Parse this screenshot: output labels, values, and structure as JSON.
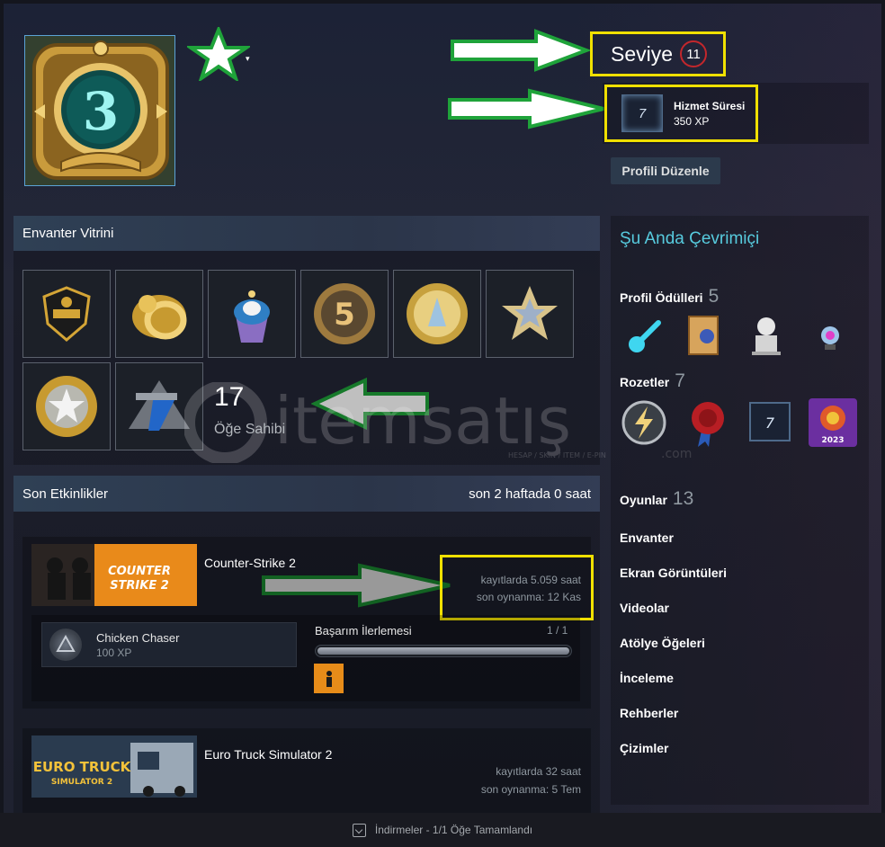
{
  "profile": {
    "level_label": "Seviye",
    "level": "11",
    "badge": {
      "title": "Hizmet Süresi",
      "xp": "350 XP",
      "glyph": "7"
    },
    "edit_label": "Profili Düzenle"
  },
  "showcase": {
    "title": "Envanter Vitrini",
    "count": "17",
    "count_label": "Öğe Sahibi"
  },
  "activity": {
    "title": "Son Etkinlikler",
    "summary": "son 2 haftada 0 saat",
    "games": [
      {
        "name": "Counter-Strike 2",
        "hours": "kayıtlarda 5.059 saat",
        "last_played": "son oynanma: 12 Kas",
        "capsule_text_1": "COUNTER",
        "capsule_text_2": "STRIKE 2"
      },
      {
        "name": "Euro Truck Simulator 2",
        "hours": "kayıtlarda 32 saat",
        "last_played": "son oynanma: 5 Tem",
        "capsule_text_1": "EURO TRUCK",
        "capsule_text_2": "SIMULATOR 2"
      }
    ],
    "achievement": {
      "name": "Chicken Chaser",
      "xp": "100 XP",
      "progress_label": "Başarım İlerlemesi",
      "progress_count": "1 / 1",
      "progress_fraction": 1.0
    }
  },
  "sidebar": {
    "status": "Şu Anda Çevrimiçi",
    "awards_label": "Profil Ödülleri",
    "awards_count": "5",
    "badges_label": "Rozetler",
    "badges_count": "7",
    "badge_year": "2023",
    "games_label": "Oyunlar",
    "games_count": "13",
    "links": [
      "Envanter",
      "Ekran Görüntüleri",
      "Videolar",
      "Atölye Öğeleri",
      "İnceleme",
      "Rehberler",
      "Çizimler"
    ]
  },
  "watermark": {
    "brand": "itemsatış",
    "tagline": "HESAP / SKIN / ITEM / E-PIN",
    "suffix": ".com"
  },
  "downloads": {
    "status": "İndirmeler - 1/1 Öğe Tamamlandı"
  },
  "colors": {
    "accent_status": "#57cbde",
    "highlight_box": "#f0e000",
    "arrow_fill": "#ffffff",
    "arrow_stroke": "#1fa33a",
    "level_ring": "#c3272c"
  }
}
